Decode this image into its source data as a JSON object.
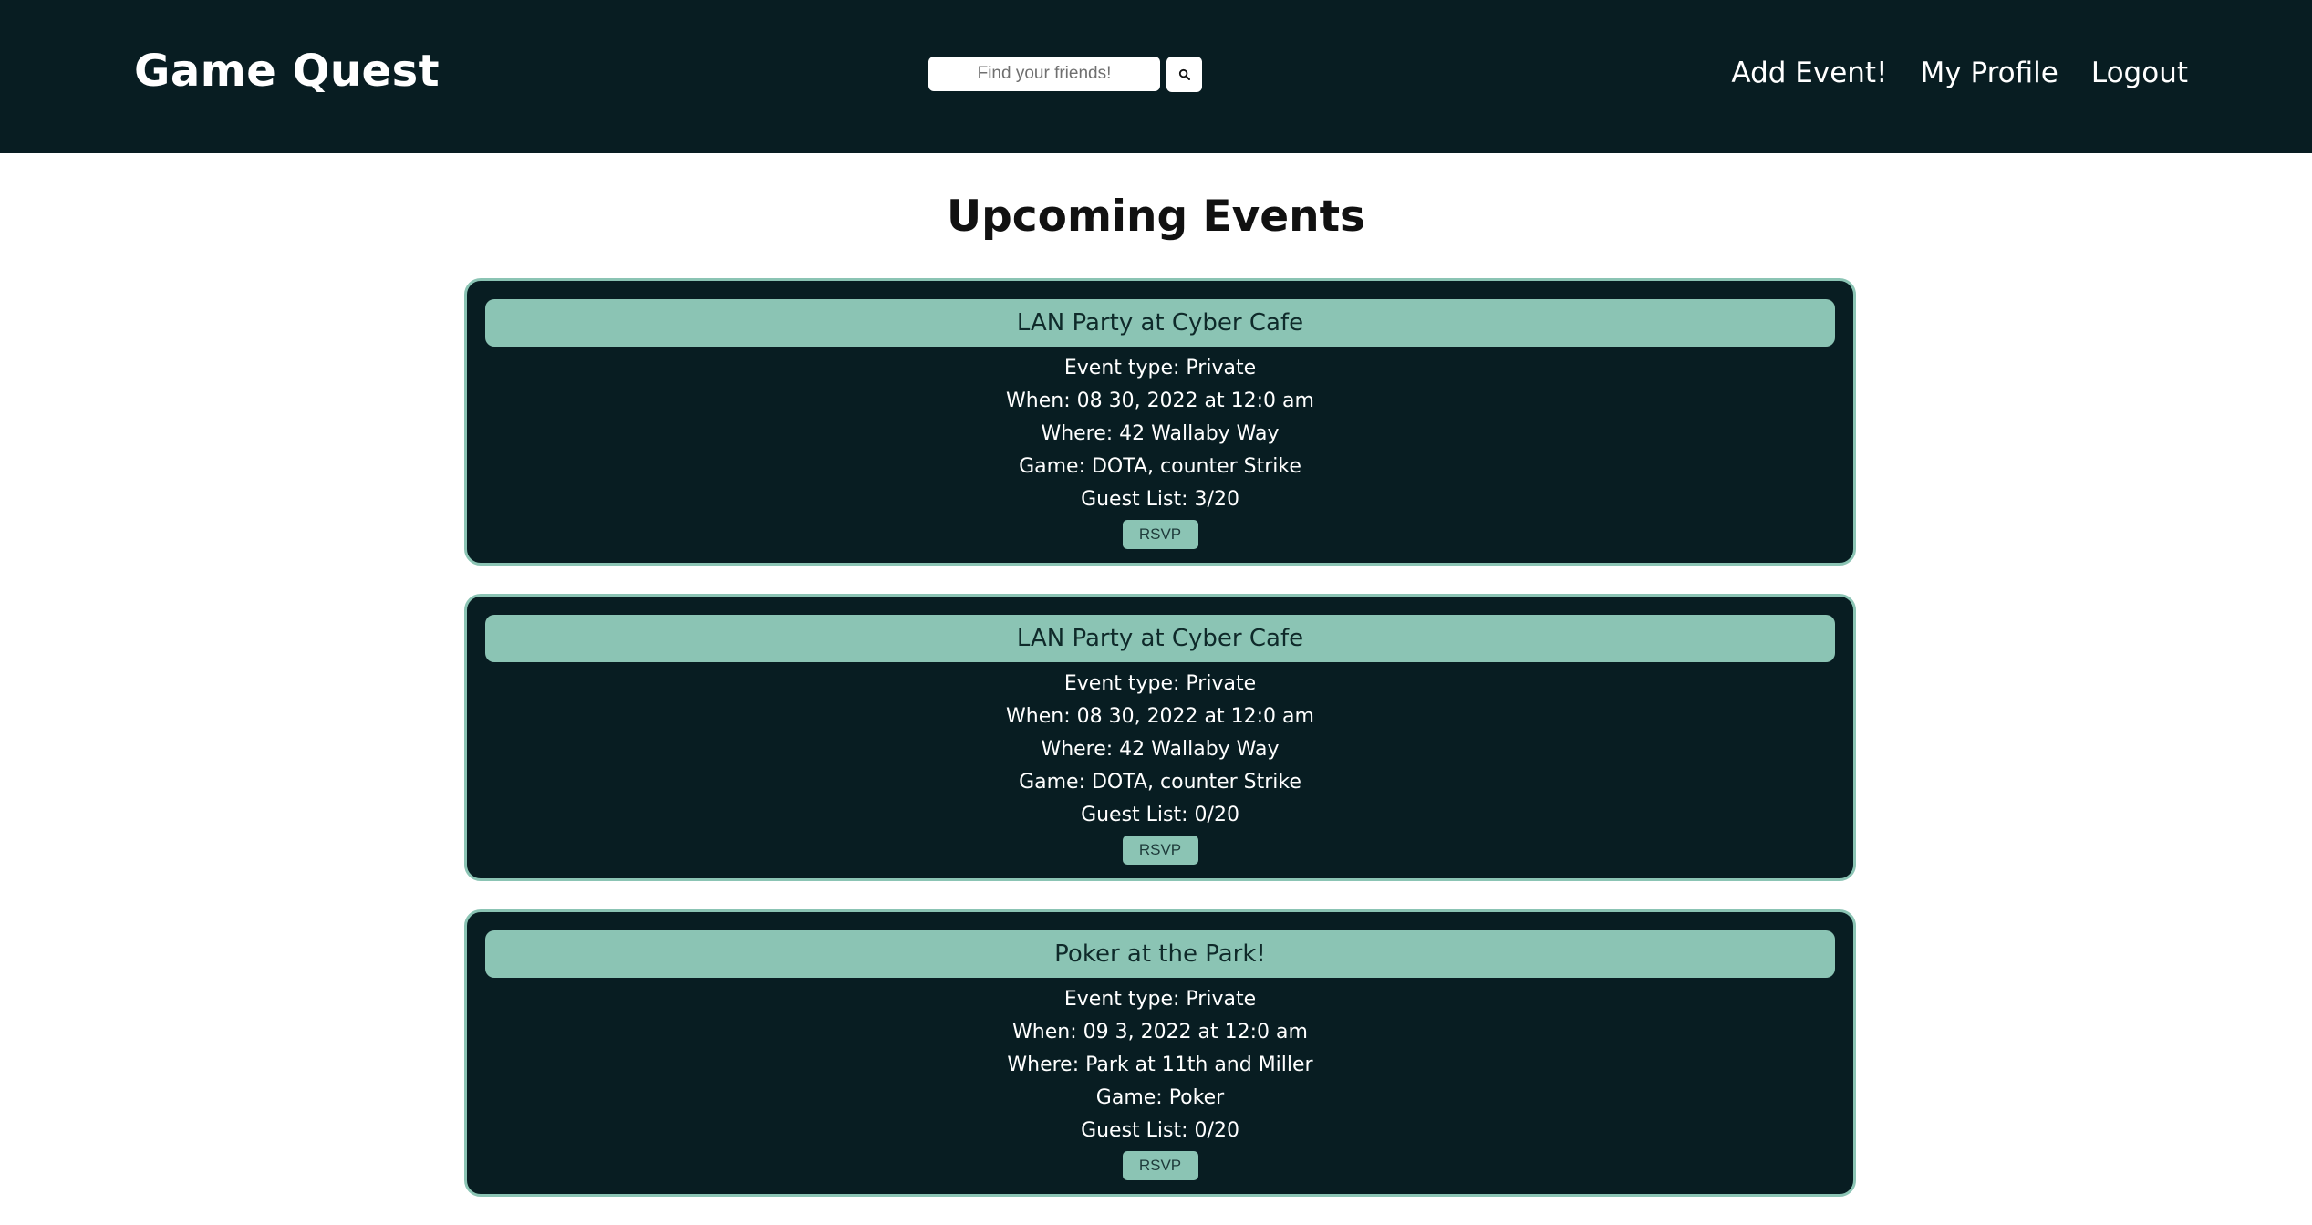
{
  "header": {
    "brand": "Game Quest",
    "search": {
      "placeholder": "Find your friends!",
      "value": ""
    },
    "search_icon": "magnifier-icon",
    "nav": [
      {
        "label": "Add Event!"
      },
      {
        "label": "My Profile"
      },
      {
        "label": "Logout"
      }
    ]
  },
  "main": {
    "title": "Upcoming Events",
    "events": [
      {
        "title": "LAN Party at Cyber Cafe",
        "type": "Event type: Private",
        "when": "When: 08 30, 2022 at 12:0 am",
        "where": "Where: 42 Wallaby Way",
        "game": "Game: DOTA, counter Strike",
        "guests": "Guest List: 3/20",
        "rsvp": "RSVP"
      },
      {
        "title": "LAN Party at Cyber Cafe",
        "type": "Event type: Private",
        "when": "When: 08 30, 2022 at 12:0 am",
        "where": "Where: 42 Wallaby Way",
        "game": "Game: DOTA, counter Strike",
        "guests": "Guest List: 0/20",
        "rsvp": "RSVP"
      },
      {
        "title": "Poker at the Park!",
        "type": "Event type: Private",
        "when": "When: 09 3, 2022 at 12:0 am",
        "where": "Where: Park at 11th and Miller",
        "game": "Game: Poker",
        "guests": "Guest List: 0/20",
        "rsvp": "RSVP"
      }
    ]
  },
  "colors": {
    "header_bg": "#081d22",
    "card_bg": "#081d22",
    "accent": "#8bc4b4",
    "page_bg": "#ffffff"
  }
}
